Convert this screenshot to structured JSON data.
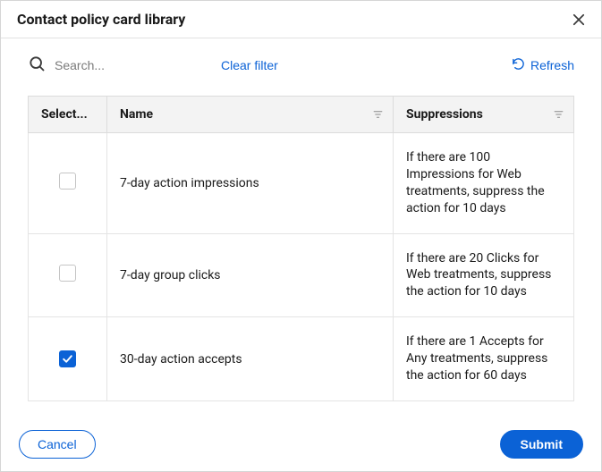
{
  "header": {
    "title": "Contact policy card library"
  },
  "toolbar": {
    "search_placeholder": "Search...",
    "clear_filter_label": "Clear filter",
    "refresh_label": "Refresh"
  },
  "table": {
    "headers": {
      "select": "Select...",
      "name": "Name",
      "suppressions": "Suppressions"
    },
    "rows": [
      {
        "checked": false,
        "name": "7-day action impressions",
        "suppressions": "If there are 100 Impressions for Web treatments, suppress the action for 10 days"
      },
      {
        "checked": false,
        "name": "7-day group clicks",
        "suppressions": "If there are 20 Clicks for Web treatments, suppress the action for 10 days"
      },
      {
        "checked": true,
        "name": "30-day action accepts",
        "suppressions": "If there are 1 Accepts for Any treatments, suppress the action for 60 days"
      }
    ]
  },
  "footer": {
    "cancel_label": "Cancel",
    "submit_label": "Submit"
  }
}
